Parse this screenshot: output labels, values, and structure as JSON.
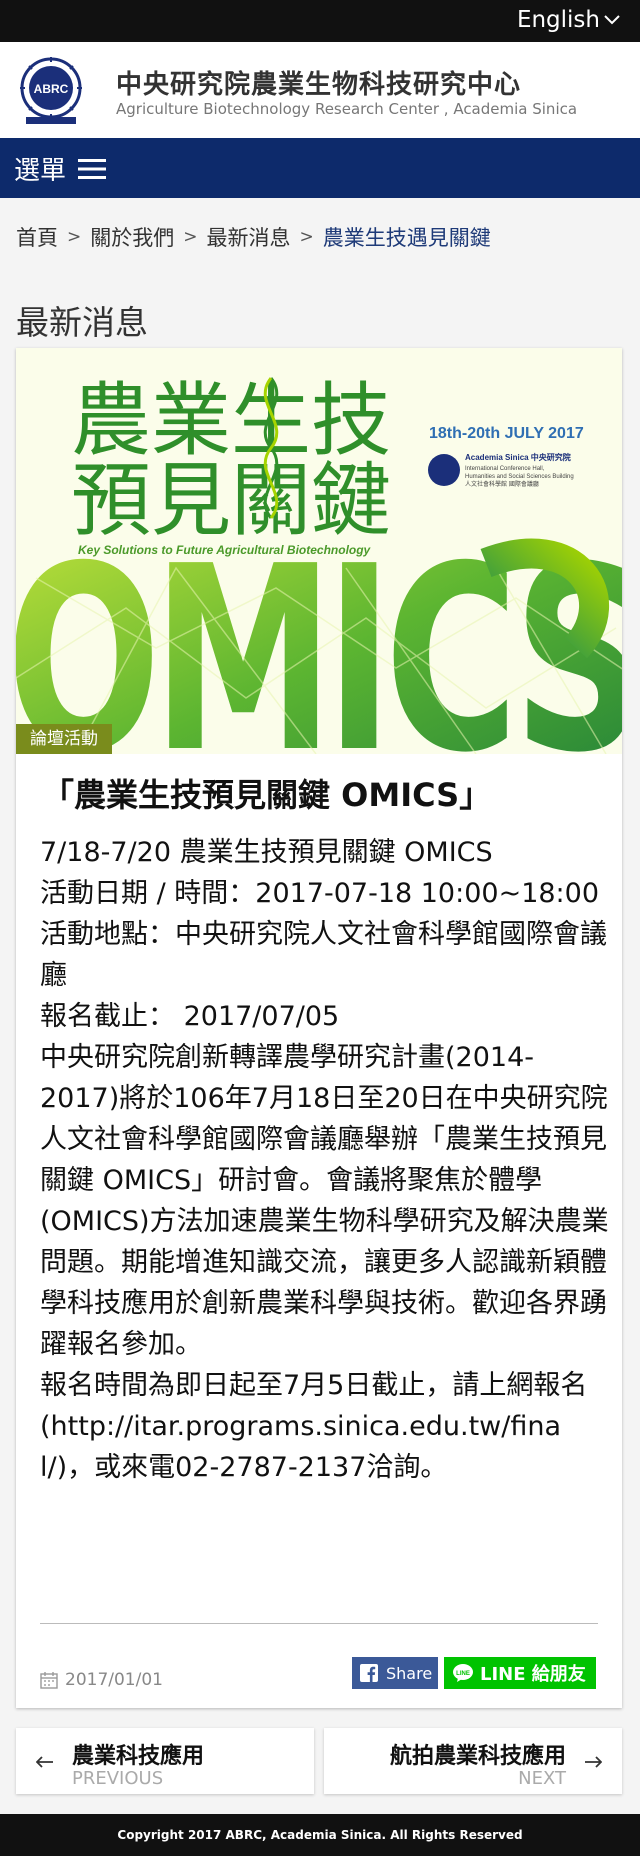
{
  "topbar": {
    "language_link": "English"
  },
  "header": {
    "logo_text": "ABRC",
    "title_zh": "中央研究院農業生物科技研究中心",
    "title_en": "Agriculture Biotechnology Research Center , Academia Sinica"
  },
  "menu": {
    "label": "選單"
  },
  "breadcrumb": [
    "首頁",
    "關於我們",
    "最新消息",
    "農業生技遇見關鍵"
  ],
  "section_title": "最新消息",
  "banner": {
    "title_line1": "農業生技",
    "title_line2": "預見關鍵",
    "subtitle": "Key Solutions to Future Agricultural Biotechnology",
    "dates": "18th-20th JULY 2017",
    "venue_line1": "Academia Sinica 中央研究院",
    "venue_line2": "International Conference Hall,",
    "venue_line3": "Humanities and Social Sciences Building",
    "venue_line4": "人文社會科學館 國際會議廳",
    "big_word": "OMICS",
    "category_tag": "論壇活動"
  },
  "post": {
    "title": "「農業生技預見關鍵 OMICS」",
    "lines": [
      "7/18-7/20 農業生技預見關鍵 OMICS",
      "活動日期 / 時間：2017-07-18 10:00~18:00",
      "活動地點：中央研究院人文社會科學館國際會議廳",
      "報名截止： 2017/07/05",
      "中央研究院創新轉譯農學研究計畫(2014-2017)將於106年7月18日至20日在中央研究院人文社會科學館國際會議廳舉辦「農業生技預見關鍵 OMICS」研討會。會議將聚焦於體學(OMICS)方法加速農業生物科學研究及解決農業問題。期能增進知識交流，讓更多人認識新穎體學科技應用於創新農業科學與技術。歡迎各界踴躍報名參加。",
      "報名時間為即日起至7月5日截止，請上網報名(http://itar.programs.sinica.edu.tw/final/)，或來電02-2787-2137洽詢。"
    ],
    "date": "2017/01/01",
    "fb_share_label": "Share",
    "line_share_label": "LINE 給朋友"
  },
  "pager": {
    "prev_title": "農業科技應用",
    "prev_label": "PREVIOUS",
    "next_title": "航拍農業科技應用",
    "next_label": "NEXT"
  },
  "footer": {
    "copyright": "Copyright 2017 ABRC, Academia Sinica. All Rights Reserved"
  },
  "colors": {
    "nav_blue": "#0d2a6b",
    "tag_green": "#7a8c1c",
    "facebook": "#3b5998",
    "line_green": "#00c300",
    "banner_green": "#2f8f2a",
    "banner_lime": "#a6d400"
  }
}
